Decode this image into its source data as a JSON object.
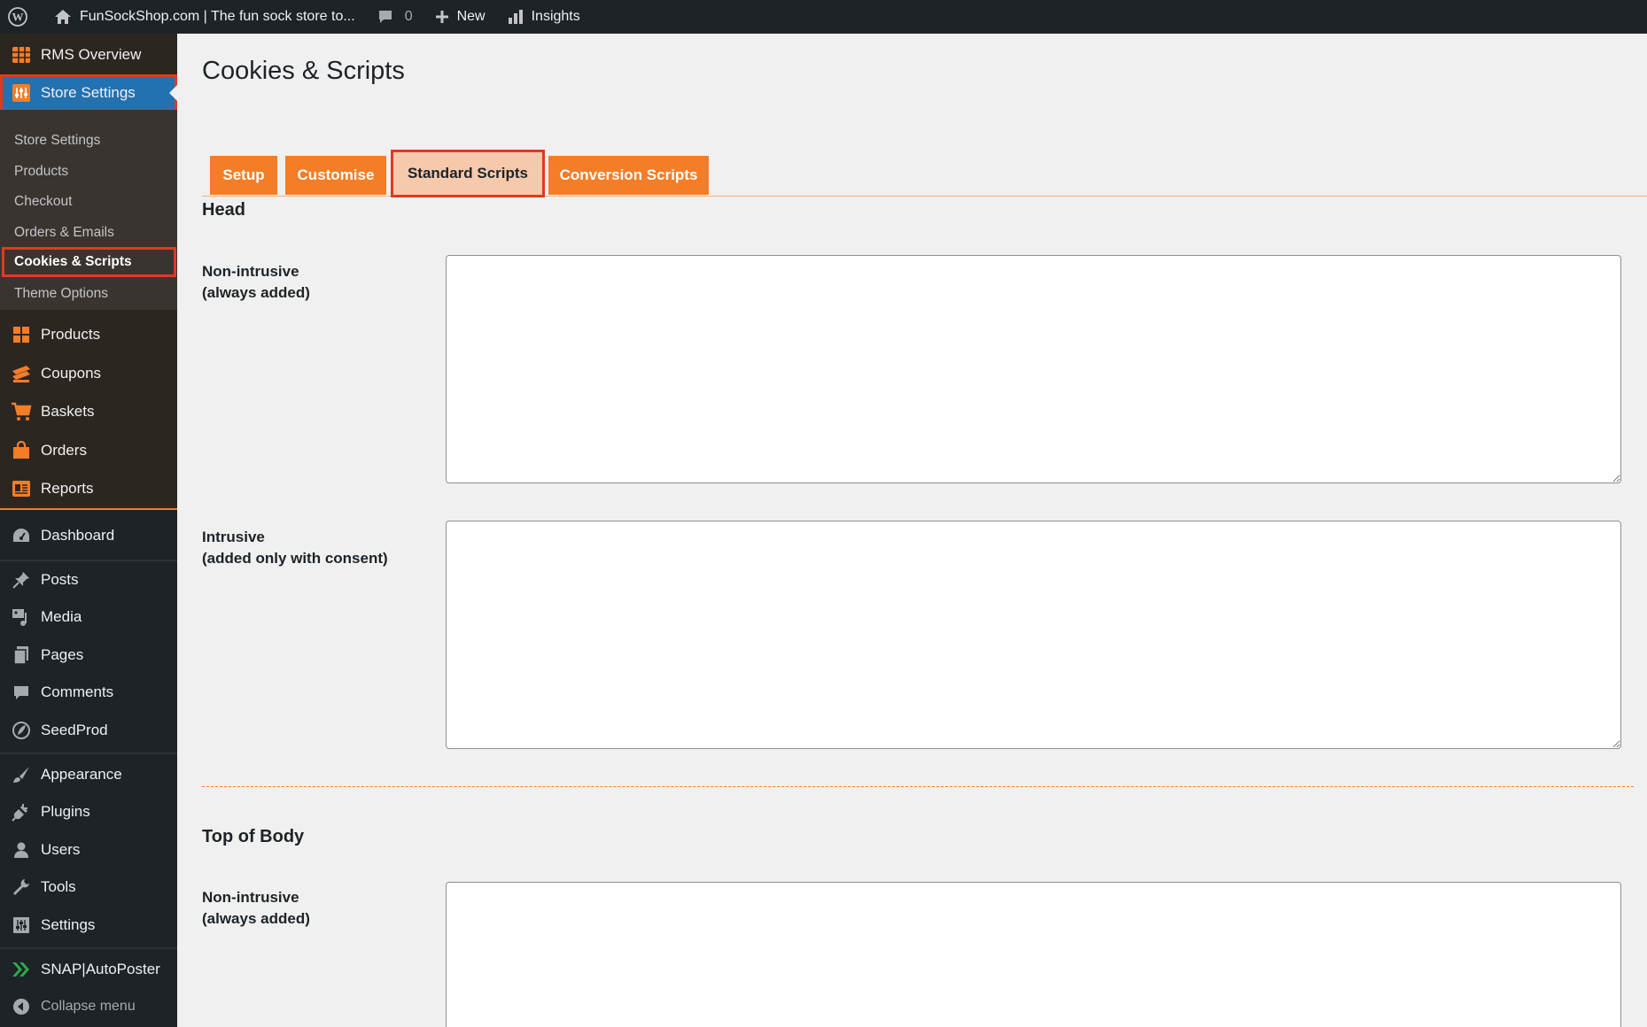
{
  "admin_bar": {
    "site_name": "FunSockShop.com | The fun sock store to...",
    "comments_count": "0",
    "new_label": "New",
    "insights_label": "Insights"
  },
  "sidebar": {
    "rms_items": [
      {
        "label": "RMS Overview",
        "icon": "table-grid-icon"
      },
      {
        "label": "Store Settings",
        "icon": "settings-sliders-icon"
      }
    ],
    "submenu": [
      {
        "label": "Store Settings"
      },
      {
        "label": "Products"
      },
      {
        "label": "Checkout"
      },
      {
        "label": "Orders & Emails"
      },
      {
        "label": "Cookies & Scripts"
      },
      {
        "label": "Theme Options"
      }
    ],
    "rms_more": [
      {
        "label": "Products",
        "icon": "grid-icon"
      },
      {
        "label": "Coupons",
        "icon": "coupon-icon"
      },
      {
        "label": "Baskets",
        "icon": "cart-icon"
      },
      {
        "label": "Orders",
        "icon": "bag-icon"
      },
      {
        "label": "Reports",
        "icon": "report-icon"
      }
    ],
    "wp_items": [
      {
        "label": "Dashboard",
        "icon": "dashboard-icon"
      },
      {
        "label": "Posts",
        "icon": "pin-icon"
      },
      {
        "label": "Media",
        "icon": "media-icon"
      },
      {
        "label": "Pages",
        "icon": "pages-icon"
      },
      {
        "label": "Comments",
        "icon": "comment-icon"
      },
      {
        "label": "SeedProd",
        "icon": "seedprod-icon"
      },
      {
        "label": "Appearance",
        "icon": "brush-icon"
      },
      {
        "label": "Plugins",
        "icon": "plug-icon"
      },
      {
        "label": "Users",
        "icon": "user-icon"
      },
      {
        "label": "Tools",
        "icon": "wrench-icon"
      },
      {
        "label": "Settings",
        "icon": "settings-sliders-icon"
      },
      {
        "label": "SNAP|AutoPoster",
        "icon": "arrows-icon"
      },
      {
        "label": "Collapse menu",
        "icon": "collapse-icon"
      }
    ]
  },
  "main": {
    "title": "Cookies & Scripts",
    "tabs": [
      {
        "label": "Setup"
      },
      {
        "label": "Customise"
      },
      {
        "label": "Standard Scripts"
      },
      {
        "label": "Conversion Scripts"
      }
    ],
    "sections": [
      {
        "title": "Head",
        "fields": [
          {
            "label_line1": "Non-intrusive",
            "label_line2": "(always added)",
            "value": ""
          },
          {
            "label_line1": "Intrusive",
            "label_line2": "(added only with consent)",
            "value": ""
          }
        ]
      },
      {
        "title": "Top of Body",
        "fields": [
          {
            "label_line1": "Non-intrusive",
            "label_line2": "(always added)",
            "value": ""
          }
        ]
      }
    ]
  },
  "colors": {
    "accent_orange": "#f47d28",
    "active_tab_bg": "#f7c9ac",
    "highlight_red": "#e03a1f",
    "wp_blue": "#2271b1",
    "admin_dark": "#1d2327"
  }
}
